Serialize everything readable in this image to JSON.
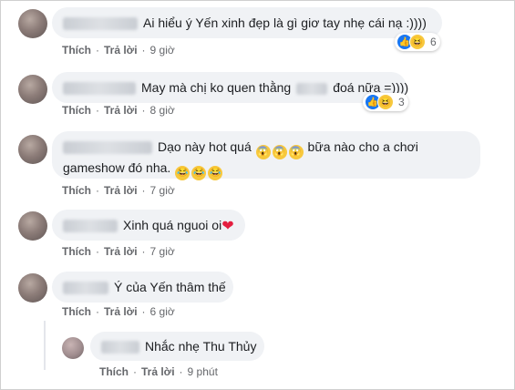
{
  "comments": [
    {
      "text": "Ai hiểu ý Yến xinh đẹp là gì giơ tay nhẹ cái nạ :))))",
      "like": "Thích",
      "reply": "Trả lời",
      "time": "9 giờ",
      "reaction_count": "6"
    },
    {
      "text_before": "May mà chị ko quen thằng",
      "text_after": "đoá nữa =))))",
      "like": "Thích",
      "reply": "Trả lời",
      "time": "8 giờ",
      "reaction_count": "3"
    },
    {
      "line1": "Dạo này hot quá",
      "line1_after": "bữa nào cho a chơi",
      "line2": "gameshow đó nha.",
      "like": "Thích",
      "reply": "Trả lời",
      "time": "7 giờ"
    },
    {
      "text": "Xinh quá nguoi oi",
      "like": "Thích",
      "reply": "Trả lời",
      "time": "7 giờ"
    },
    {
      "text": "Ý của Yến thâm thế",
      "like": "Thích",
      "reply": "Trả lời",
      "time": "6 giờ"
    },
    {
      "text": "Nhắc nhẹ Thu Thủy",
      "like": "Thích",
      "reply": "Trả lời",
      "time": "9 phút"
    }
  ],
  "colors": {
    "bubble": "#f0f2f5",
    "meta": "#65676b",
    "like_blue": "#1877f2",
    "haha_yellow": "#f7c83d",
    "heart_red": "#e41e3f"
  },
  "icons": {
    "like": "thumbs-up-icon",
    "haha": "haha-face-icon",
    "scream": "scream-face-icon",
    "tears": "tears-of-joy-icon",
    "heart": "heart-icon"
  }
}
